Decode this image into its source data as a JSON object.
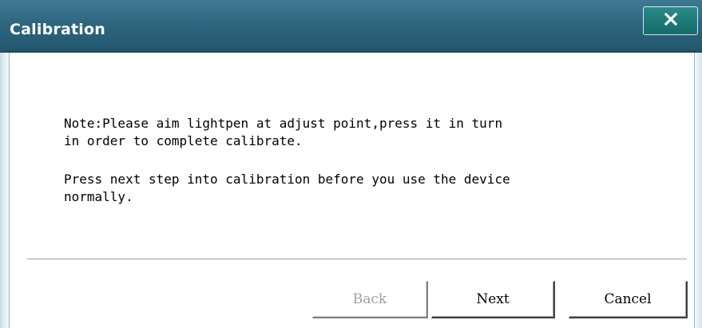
{
  "window": {
    "title": "Calibration",
    "close_label": "×"
  },
  "content": {
    "note_line1": "Note:Please aim lightpen at adjust point,press it in turn\nin order to complete calibrate.",
    "note_line2": "Press next step into calibration before you use the device\nnormally."
  },
  "buttons": {
    "back": {
      "label": "Back",
      "enabled": false
    },
    "next": {
      "label": "Next",
      "enabled": true
    },
    "cancel": {
      "label": "Cancel",
      "enabled": true
    }
  },
  "colors": {
    "titlebar": "#2f667f",
    "close_button": "#1f7a78",
    "disabled_text": "#a0a0a0"
  },
  "icons": {
    "close": "close-icon"
  }
}
